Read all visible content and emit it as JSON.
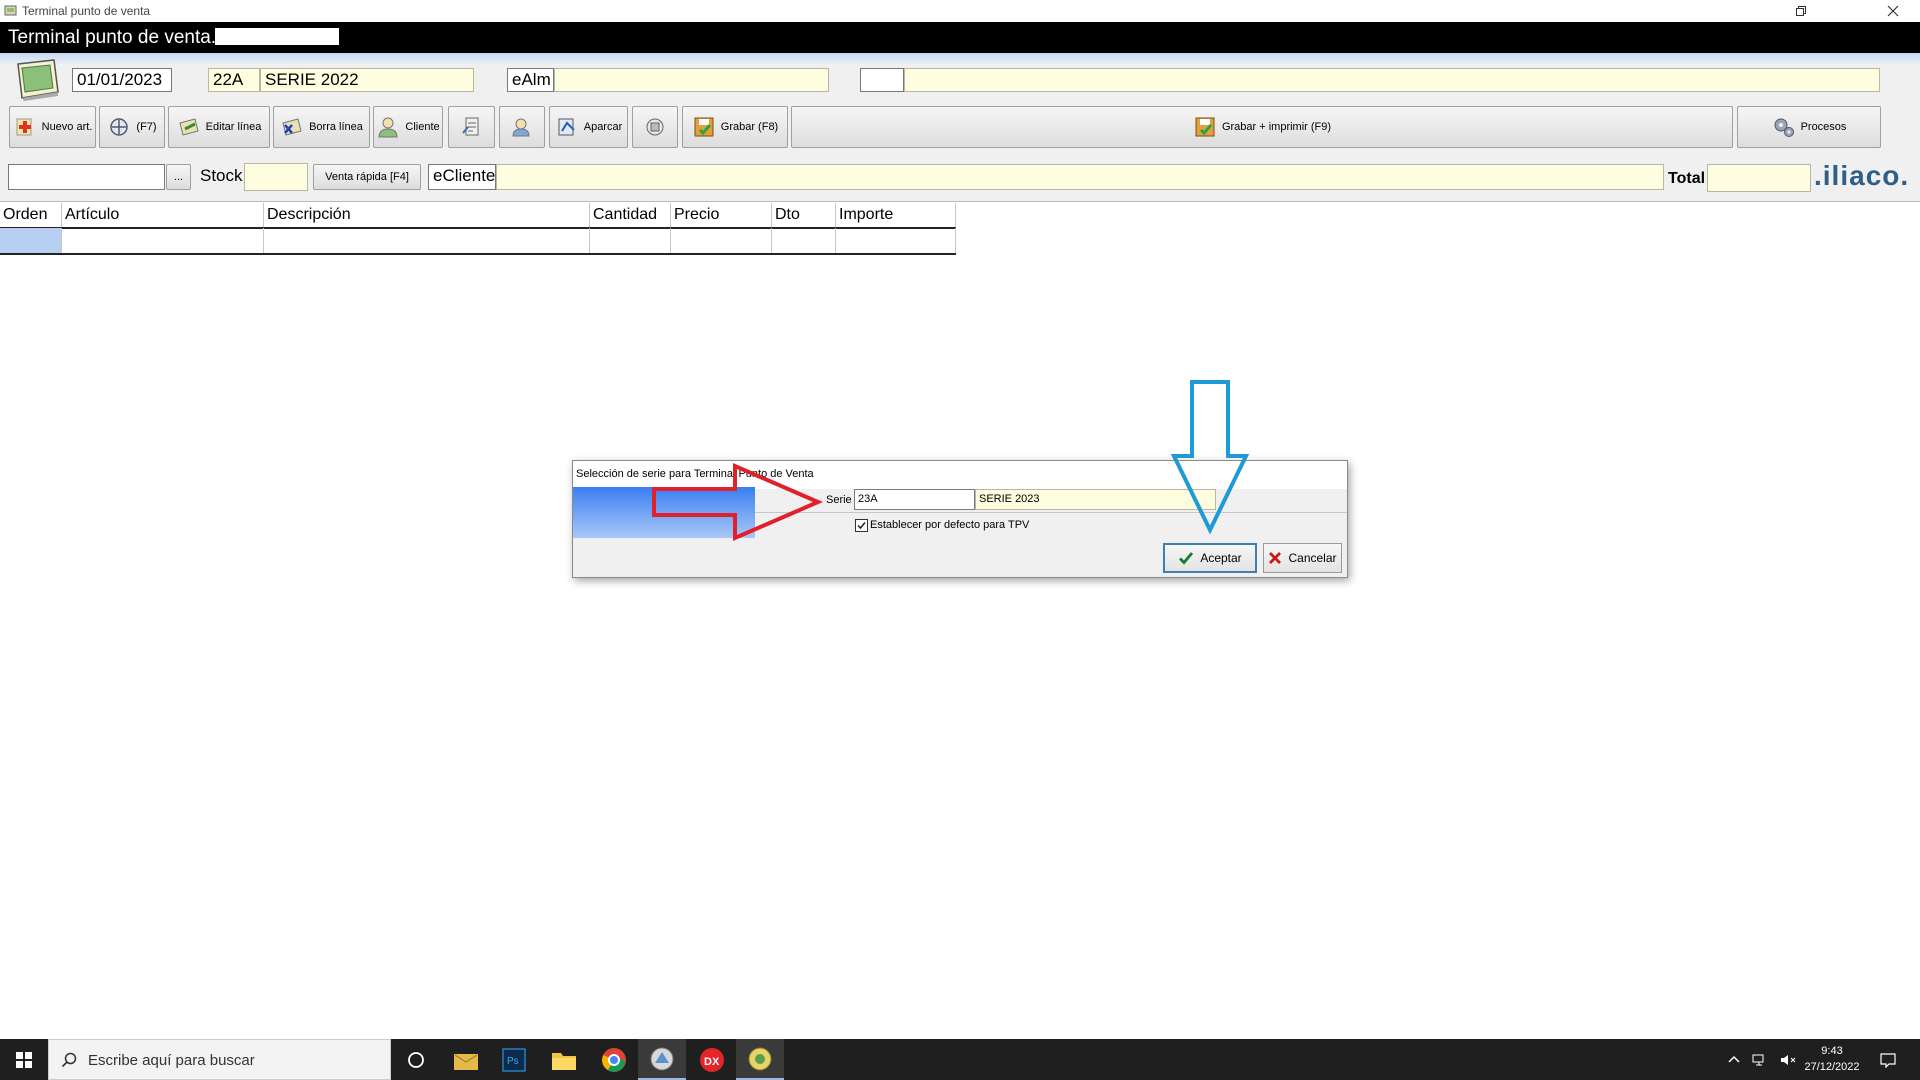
{
  "window": {
    "title": "Terminal punto de venta",
    "header_title": "Terminal punto de venta."
  },
  "header": {
    "date": "01/01/2023",
    "serie_code": "22A",
    "serie_name": "SERIE 2022",
    "almacen_code": "eAlm",
    "almacen_name": "",
    "extra_code": "",
    "extra_name": ""
  },
  "toolbar": {
    "nuevo": "Nuevo art.",
    "f7": "(F7)",
    "editar": "Editar línea",
    "borra": "Borra línea",
    "cliente": "Cliente",
    "aparcar": "Aparcar",
    "grabar": "Grabar (F8)",
    "grabar_imprimir": "Grabar + imprimir (F9)",
    "procesos": "Procesos"
  },
  "line": {
    "article_value": "",
    "browse_label": "...",
    "stock_label": "Stock",
    "stock_value": "",
    "venta_rapida": "Venta rápida [F4]",
    "cliente_code": "eCliente",
    "cliente_name": "",
    "total_label": "Total",
    "total_value": "",
    "brand": ".iliaco."
  },
  "grid": {
    "columns": [
      "Orden",
      "Artículo",
      "Descripción",
      "Cantidad",
      "Precio",
      "Dto",
      "Importe"
    ]
  },
  "dialog": {
    "title": "Selección de serie para Terminal Punto de Venta",
    "serie_label": "Serie",
    "serie_code": "23A",
    "serie_name": "SERIE 2023",
    "default_label": "Establecer por defecto para TPV",
    "default_checked": true,
    "accept": "Aceptar",
    "cancel": "Cancelar"
  },
  "annotations": {
    "red_arrow_color": "#e0202a",
    "blue_arrow_color": "#1e9ad6"
  },
  "taskbar": {
    "search_placeholder": "Escribe aquí para buscar",
    "time": "9:43",
    "date": "27/12/2022"
  }
}
